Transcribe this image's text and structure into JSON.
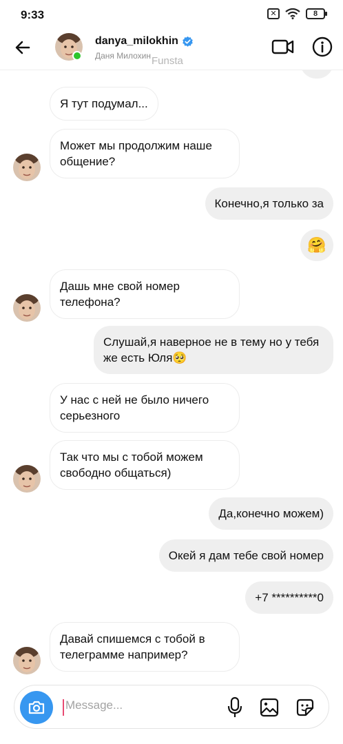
{
  "status_bar": {
    "time": "9:33",
    "battery": "8"
  },
  "header": {
    "username": "danya_milokhin",
    "full_name": "Даня Милохин",
    "watermark": "Funsta",
    "icons": [
      "back-arrow-icon",
      "verified-badge-icon",
      "video-call-icon",
      "info-icon"
    ]
  },
  "messages": [
    {
      "from": "them",
      "text": "Я тут подумал..."
    },
    {
      "from": "them",
      "text": "Может мы продолжим наше общение?"
    },
    {
      "from": "me",
      "text": "Конечно,я только за"
    },
    {
      "from": "me",
      "text": "🤗"
    },
    {
      "from": "them",
      "text": "Дашь мне свой номер телефона?"
    },
    {
      "from": "me",
      "text": "Слушай,я наверное не в тему но у тебя же есть Юля🥺"
    },
    {
      "from": "them",
      "text": "У нас с ней не было ничего серьезного"
    },
    {
      "from": "them",
      "text": "Так что мы с тобой можем свободно общаться)"
    },
    {
      "from": "me",
      "text": "Да,конечно можем)"
    },
    {
      "from": "me",
      "text": "Окей я дам тебе свой номер"
    },
    {
      "from": "me",
      "text": "+7 **********0"
    },
    {
      "from": "them",
      "text": "Давай спишемся с тобой в телеграмме например?"
    }
  ],
  "composer": {
    "placeholder": "Message...",
    "icons": [
      "camera-icon",
      "microphone-icon",
      "gallery-icon",
      "sticker-icon"
    ]
  },
  "colors": {
    "accent": "#3797f0",
    "online": "#2dc52d",
    "outgoing_bubble": "#efefef"
  }
}
